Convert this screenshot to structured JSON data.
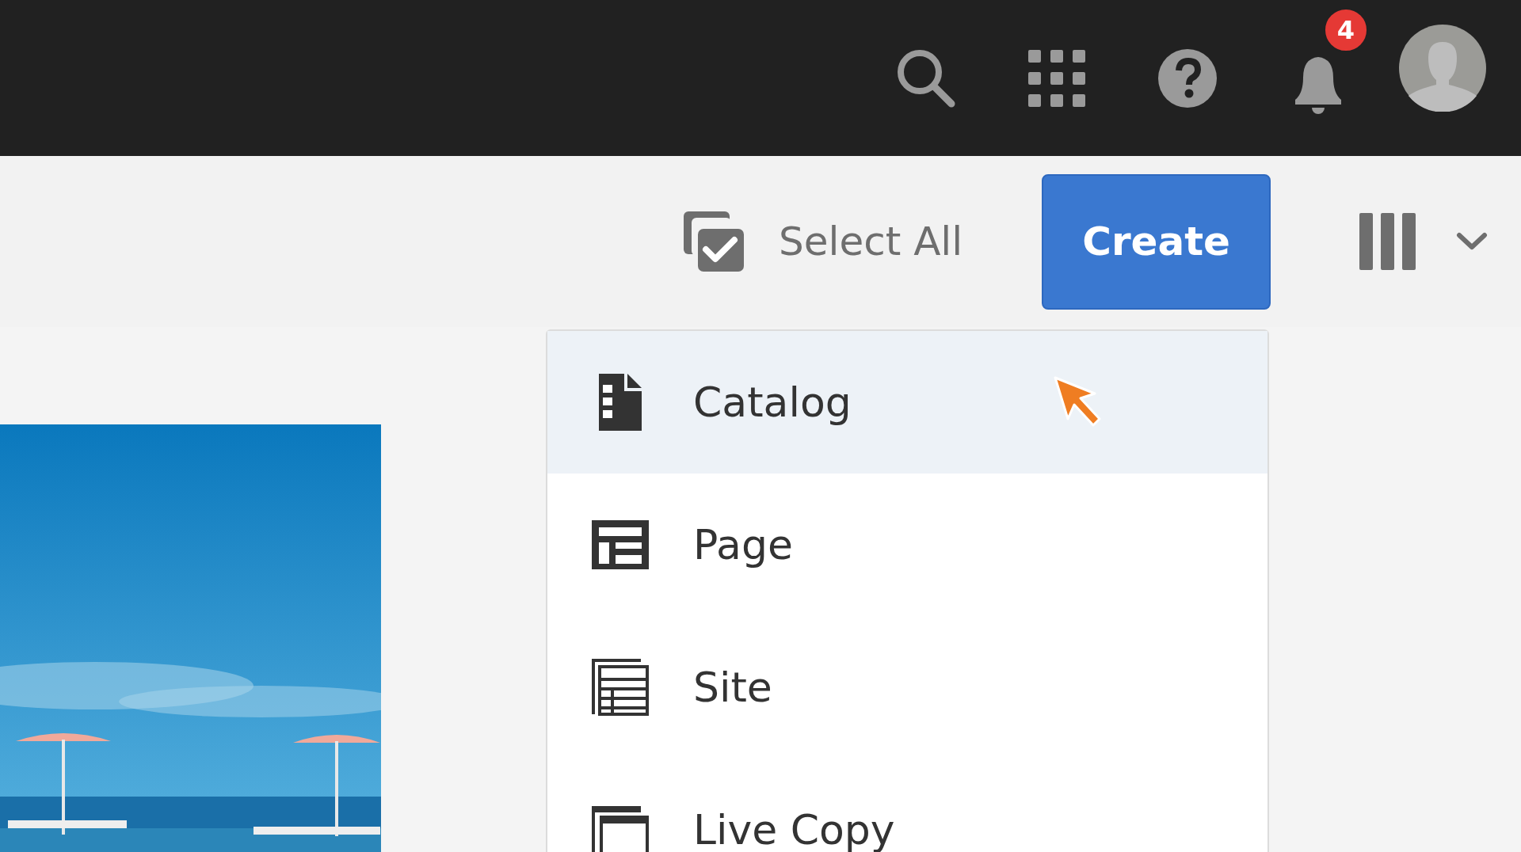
{
  "header": {
    "notification_count": "4"
  },
  "toolbar": {
    "select_all": "Select All",
    "create": "Create"
  },
  "create_menu": [
    {
      "label": "Catalog",
      "selected": true
    },
    {
      "label": "Page",
      "selected": false
    },
    {
      "label": "Site",
      "selected": false
    },
    {
      "label": "Live Copy",
      "selected": false
    }
  ]
}
